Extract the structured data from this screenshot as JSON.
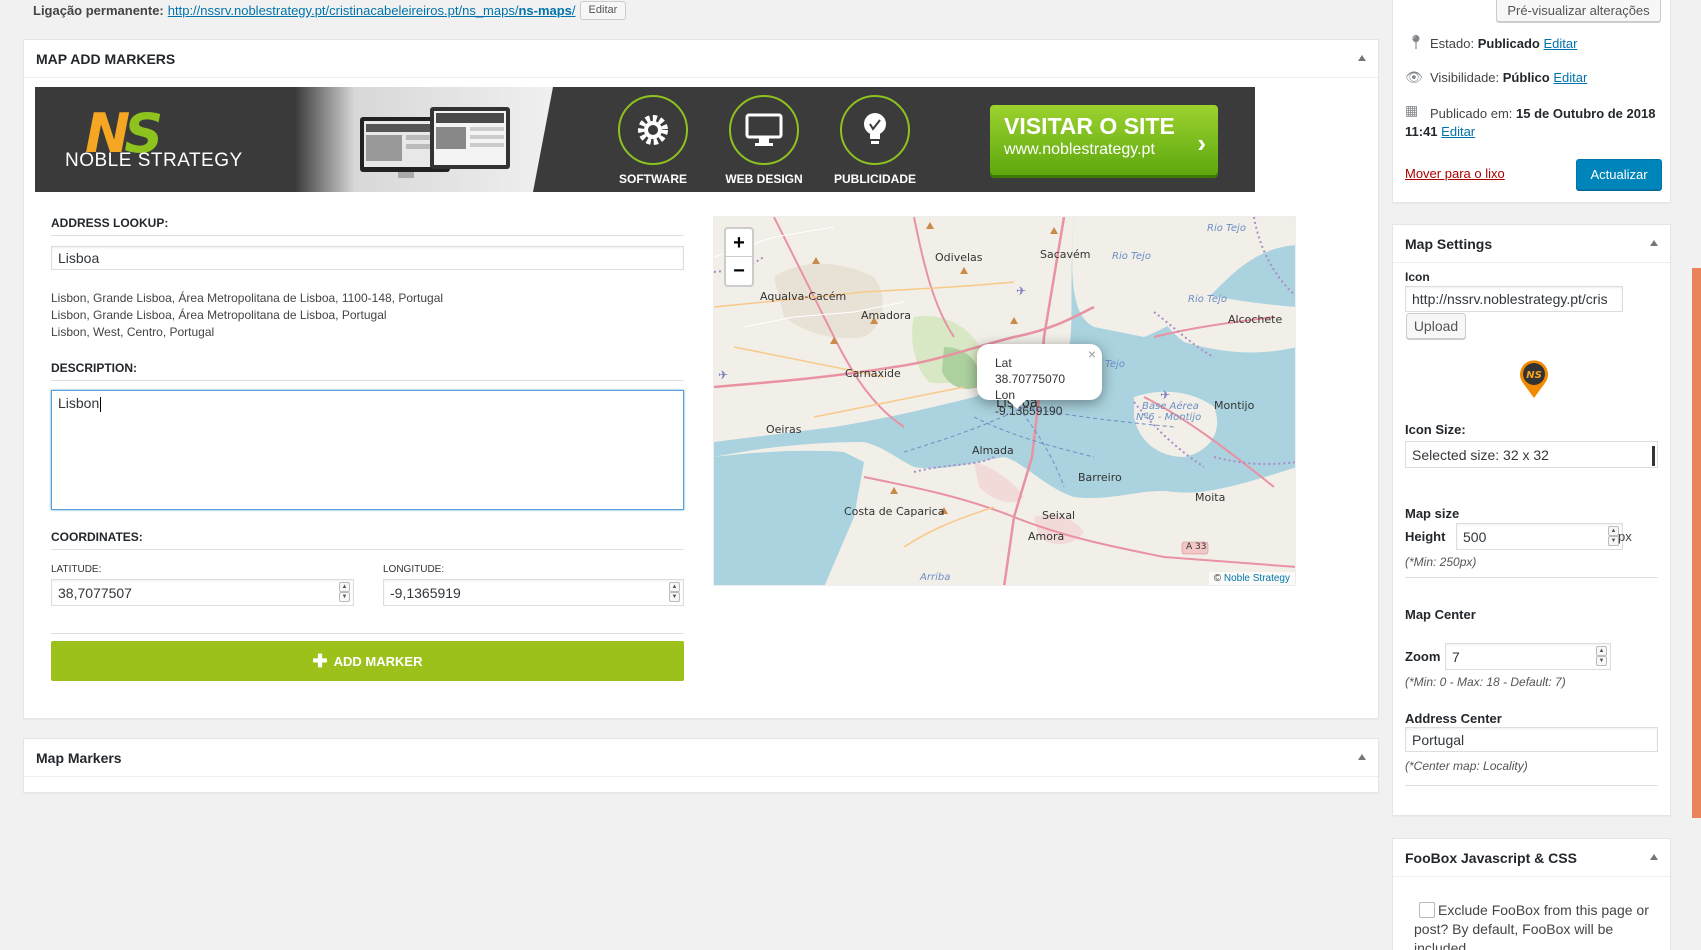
{
  "permalink": {
    "label": "Ligação permanente:",
    "url_prefix": "http://nssrv.noblestrategy.pt/cristinacabeleireiros.pt/ns_maps/",
    "url_slug": "ns-maps",
    "url_suffix": "/",
    "edit_label": "Editar"
  },
  "add_markers_box": {
    "title": "MAP ADD MARKERS",
    "banner": {
      "logo_text": "NOBLE STRATEGY",
      "services": [
        "SOFTWARE",
        "WEB DESIGN",
        "PUBLICIDADE"
      ],
      "visit_title": "VISITAR O SITE",
      "visit_url": "www.noblestrategy.pt"
    },
    "address_lookup_label": "ADDRESS LOOKUP:",
    "address_value": "Lisboa",
    "results": [
      "Lisbon, Grande Lisboa, Área Metropolitana de Lisboa, 1100-148, Portugal",
      "Lisbon, Grande Lisboa, Área Metropolitana de Lisboa, Portugal",
      "Lisbon, West, Centro, Portugal"
    ],
    "description_label": "DESCRIPTION:",
    "description_value": "Lisbon",
    "coordinates_label": "COORDINATES:",
    "latitude_label": "LATITUDE:",
    "latitude_value": "38,7077507",
    "longitude_label": "LONGITUDE:",
    "longitude_value": "-9,1365919",
    "add_marker_label": "ADD MARKER"
  },
  "map": {
    "zoom_in": "+",
    "zoom_out": "−",
    "popup_lat": "Lat 38.70775070",
    "popup_lon": "Lon -9.13659190",
    "popup_close": "×",
    "attribution_prefix": "© ",
    "attribution_link": "Noble Strategy",
    "labels": [
      "Odivelas",
      "Sacavém",
      "Aqualva-Cacém",
      "Amadora",
      "Carnaxide",
      "Oeiras",
      "Lisboa",
      "Almada",
      "Barreiro",
      "Montijo",
      "Alcochete",
      "Moita",
      "Seixal",
      "Amora",
      "Costa de Caparica",
      "Rio Tejo",
      "Rio Tejo",
      "Rio Tejo",
      "Rio Tejo",
      "Base Aérea",
      "Nº6 - Montijo",
      "A 33",
      "Arriba"
    ]
  },
  "map_markers_box": {
    "title": "Map Markers"
  },
  "publish_box": {
    "preview_label": "Pré-visualizar alterações",
    "status_label": "Estado:",
    "status_value": "Publicado",
    "visibility_label": "Visibilidade:",
    "visibility_value": "Público",
    "published_label": "Publicado em:",
    "published_value": "15 de Outubro de 2018",
    "published_time": "11:41",
    "edit_link": "Editar",
    "trash_label": "Mover para o lixo",
    "update_label": "Actualizar"
  },
  "map_settings": {
    "title": "Map Settings",
    "icon_label": "Icon",
    "icon_url": "http://nssrv.noblestrategy.pt/cris",
    "upload_label": "Upload",
    "icon_size_label": "Icon Size:",
    "icon_size_value": "Selected size: 32 x 32",
    "map_size_label": "Map size",
    "height_label": "Height",
    "height_value": "500",
    "height_unit": "px",
    "height_note": "(*Min: 250px)",
    "map_center_label": "Map Center",
    "zoom_label": "Zoom",
    "zoom_value": "7",
    "zoom_note": "(*Min: 0 - Max: 18 - Default: 7)",
    "address_center_label": "Address Center",
    "address_center_value": "Portugal",
    "address_center_note": "(*Center map: Locality)"
  },
  "foobox": {
    "title": "FooBox Javascript & CSS",
    "checkbox_label": "Exclude FooBox from this page or post? By default, FooBox will be included."
  },
  "colors": {
    "accent": "#0085ba",
    "add_marker": "#9bc11a",
    "trash": "#aa0000",
    "scrollbar": "#e9835a"
  }
}
